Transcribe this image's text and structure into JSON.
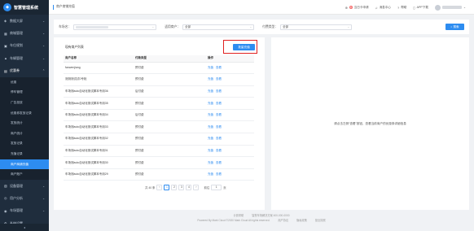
{
  "app": {
    "title": "智慧管理系统",
    "logo_char": "◆"
  },
  "sidebar": {
    "groups_top": [
      {
        "label": "数据大屏",
        "icon": "◈"
      },
      {
        "label": "商城管理",
        "icon": "▦"
      },
      {
        "label": "车位规划",
        "icon": "▣"
      },
      {
        "label": "车辆管理",
        "icon": "▲"
      }
    ],
    "open_group": {
      "label": "优惠券",
      "icon": "▤"
    },
    "sub_items": [
      {
        "label": "优惠"
      },
      {
        "label": "停车管理"
      },
      {
        "label": "广告投放"
      },
      {
        "label": "优惠券发放记录"
      },
      {
        "label": "发放统计"
      },
      {
        "label": "商户统计"
      },
      {
        "label": "发放记录"
      },
      {
        "label": "充值记录"
      },
      {
        "label": "商户商铺充值"
      },
      {
        "label": "商户账户"
      }
    ],
    "groups_bottom": [
      {
        "label": "设备管理",
        "icon": "▧"
      },
      {
        "label": "用户分析",
        "icon": "◎"
      },
      {
        "label": "车场管理",
        "icon": "◉"
      },
      {
        "label": "系统设置",
        "icon": "⚙"
      }
    ],
    "active_sub_index": 8,
    "collapse_icon": "◂"
  },
  "header": {
    "breadcrumb": "商户商铺充值",
    "items": [
      {
        "label": "当日卡申请",
        "icon": "⊕",
        "badge": "8"
      },
      {
        "label": "消息中心",
        "icon": "♫"
      },
      {
        "label": "帮助",
        "icon": "?"
      },
      {
        "label": "APP下载",
        "icon": "▯"
      }
    ]
  },
  "filter": {
    "fields": [
      {
        "label": "车场名：",
        "value": "",
        "width": 102
      },
      {
        "label": "适用商户：",
        "value": "全部",
        "width": 88
      },
      {
        "label": "付费类型：",
        "value": "全部",
        "width": 88
      }
    ],
    "search_label": "搜索",
    "search_icon": "⌕"
  },
  "left": {
    "title": "现有商户列表",
    "add_label": "批量充值",
    "columns": [
      "商户名称",
      "付款类型",
      "操作"
    ],
    "rows": [
      {
        "name": "fanwenjiang",
        "type": "预付费"
      },
      {
        "name": "测测测试试0专柜",
        "type": "预付费"
      },
      {
        "name": "车场测auto自动化测试脚本专用36",
        "type": "后付费"
      },
      {
        "name": "车场测auto自动化测试脚本专用35",
        "type": "预付费"
      },
      {
        "name": "车场测auto自动化测试脚本专用34",
        "type": "后付费"
      },
      {
        "name": "车场测auto自动化测试脚本专用33",
        "type": "预付费"
      },
      {
        "name": "车场测auto自动化测试脚本专用32",
        "type": "预付费"
      },
      {
        "name": "车场测auto自动化测试脚本专用31",
        "type": "预付费"
      },
      {
        "name": "车场测auto自动化测试脚本专用30",
        "type": "预付费"
      },
      {
        "name": "车场测auto自动化测试脚本专用29",
        "type": "预付费"
      }
    ],
    "action_recharge": "充值",
    "action_view": "查看",
    "pager": {
      "total": "共 40 条",
      "prev": "‹",
      "pages": [
        "1",
        "2",
        "3",
        "4"
      ],
      "next": "›",
      "goto_label": "前往",
      "goto_value": "1",
      "page_unit": "页"
    }
  },
  "right": {
    "empty_msg": "请点击左侧“查看”按钮，查看当前商户的优惠券详细信息"
  },
  "footer": {
    "line1": [
      "计费帮助",
      "智慧车场解决方案  400-000-0000"
    ],
    "line2": [
      "Powered By Mark Cloud ©2020 Mark Cloud All rights reserved.",
      "用户协议",
      "隐私政策",
      "营业执照"
    ]
  }
}
